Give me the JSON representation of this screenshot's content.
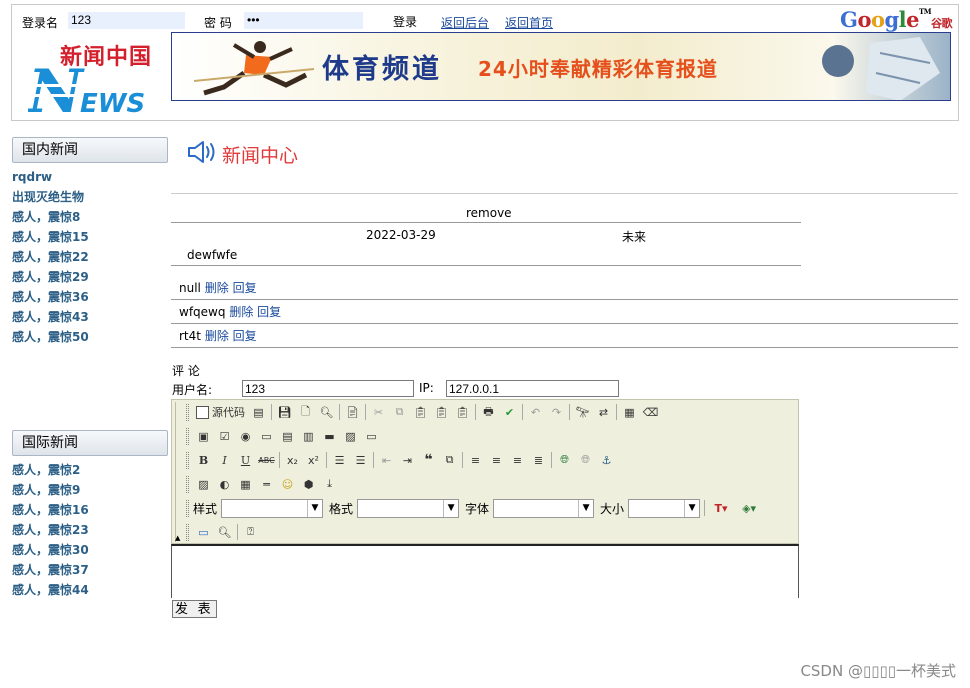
{
  "header": {
    "username_label": "登录名",
    "username_value": "123",
    "password_label": "密 码",
    "password_value": "•••",
    "login_link": "登录",
    "back_admin_link": "返回后台",
    "back_home_link": "返回首页",
    "google_text": "Google",
    "google_tm": "TM",
    "google_cn": "谷歌",
    "logo_cn": "新闻中国",
    "logo_en": "NEWS",
    "banner_title": "体育频道",
    "banner_slogan": "24小时奉献精彩体育报道"
  },
  "sidebar": {
    "domestic_title": "国内新闻",
    "domestic_items": [
      "rqdrw",
      "出现灭绝生物",
      "感人，震惊8",
      "感人，震惊15",
      "感人，震惊22",
      "感人，震惊29",
      "感人，震惊36",
      "感人，震惊43",
      "感人，震惊50"
    ],
    "intl_title": "国际新闻",
    "intl_items": [
      "感人，震惊2",
      "感人，震惊9",
      "感人，震惊16",
      "感人，震惊23",
      "感人，震惊30",
      "感人，震惊37",
      "感人，震惊44"
    ]
  },
  "article": {
    "section_title": "新闻中心",
    "title": "remove",
    "date": "2022-03-29",
    "author": "未来",
    "body": "dewfwfe"
  },
  "comments": [
    {
      "author": "null",
      "delete": "删除",
      "reply": "回复"
    },
    {
      "author": "wfqewq",
      "delete": "删除",
      "reply": "回复"
    },
    {
      "author": "rt4t",
      "delete": "删除",
      "reply": "回复"
    }
  ],
  "comment_form": {
    "heading": "评 论",
    "user_label": "用户名:",
    "user_value": "123",
    "ip_label": "IP:",
    "ip_value": "127.0.0.1",
    "source_button": "源代码",
    "style_label": "样式",
    "format_label": "格式",
    "font_label": "字体",
    "size_label": "大小",
    "bold": "B",
    "italic": "I",
    "underline": "U",
    "strike": "ABC",
    "submit": "发 表"
  },
  "watermark": "CSDN @▯▯▯▯一杯美式",
  "colors": {
    "link": "#2b5f86",
    "accent_red": "#e03a3a",
    "banner_blue": "#1e3a8a",
    "banner_orange": "#e54f1c"
  }
}
